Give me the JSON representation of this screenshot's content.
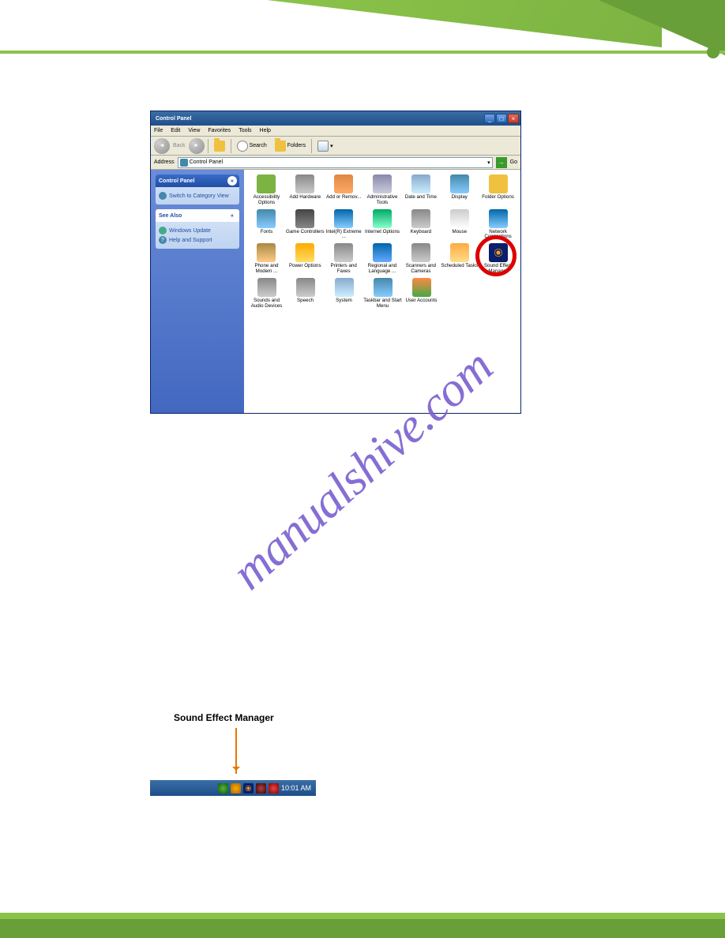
{
  "header": {},
  "window": {
    "title": "Control Panel",
    "menu": [
      "File",
      "Edit",
      "View",
      "Favorites",
      "Tools",
      "Help"
    ],
    "toolbar": {
      "back": "Back",
      "search": "Search",
      "folders": "Folders"
    },
    "address": {
      "label": "Address",
      "value": "Control Panel",
      "go": "Go"
    },
    "sidebar": {
      "panels": [
        {
          "title": "Control Panel",
          "items": [
            {
              "label": "Switch to Category View"
            }
          ]
        },
        {
          "title": "See Also",
          "items": [
            {
              "label": "Windows Update"
            },
            {
              "label": "Help and Support"
            }
          ]
        }
      ]
    },
    "icons": [
      [
        {
          "label": "Accessibility Options",
          "cls": "i-access"
        },
        {
          "label": "Add Hardware",
          "cls": "i-hw"
        },
        {
          "label": "Add or Remov...",
          "cls": "i-addrem"
        },
        {
          "label": "Administrative Tools",
          "cls": "i-admin"
        },
        {
          "label": "Date and Time",
          "cls": "i-date"
        },
        {
          "label": "Display",
          "cls": "i-disp"
        },
        {
          "label": "Folder Options",
          "cls": "i-folder"
        }
      ],
      [
        {
          "label": "Fonts",
          "cls": "i-fonts"
        },
        {
          "label": "Game Controllers",
          "cls": "i-game"
        },
        {
          "label": "Intel(R) Extreme ...",
          "cls": "i-intel"
        },
        {
          "label": "Internet Options",
          "cls": "i-inet"
        },
        {
          "label": "Keyboard",
          "cls": "i-kb"
        },
        {
          "label": "Mouse",
          "cls": "i-mouse"
        },
        {
          "label": "Network Connections",
          "cls": "i-net"
        }
      ],
      [
        {
          "label": "Phone and Modem ...",
          "cls": "i-phone"
        },
        {
          "label": "Power Options",
          "cls": "i-power"
        },
        {
          "label": "Printers and Faxes",
          "cls": "i-print"
        },
        {
          "label": "Regional and Language ...",
          "cls": "i-lang"
        },
        {
          "label": "Scanners and Cameras",
          "cls": "i-scan"
        },
        {
          "label": "Scheduled Tasks",
          "cls": "i-sched"
        },
        {
          "label": "Sound Effect Manager",
          "cls": "i-sndfx",
          "ring": true
        }
      ],
      [
        {
          "label": "Sounds and Audio Devices",
          "cls": "i-snddev"
        },
        {
          "label": "Speech",
          "cls": "i-speech"
        },
        {
          "label": "System",
          "cls": "i-sys"
        },
        {
          "label": "Taskbar and Start Menu",
          "cls": "i-task"
        },
        {
          "label": "User Accounts",
          "cls": "i-users"
        }
      ]
    ]
  },
  "watermark": "manualshive.com",
  "callout": "Sound Effect Manager",
  "tray": {
    "time": "10:01 AM"
  }
}
